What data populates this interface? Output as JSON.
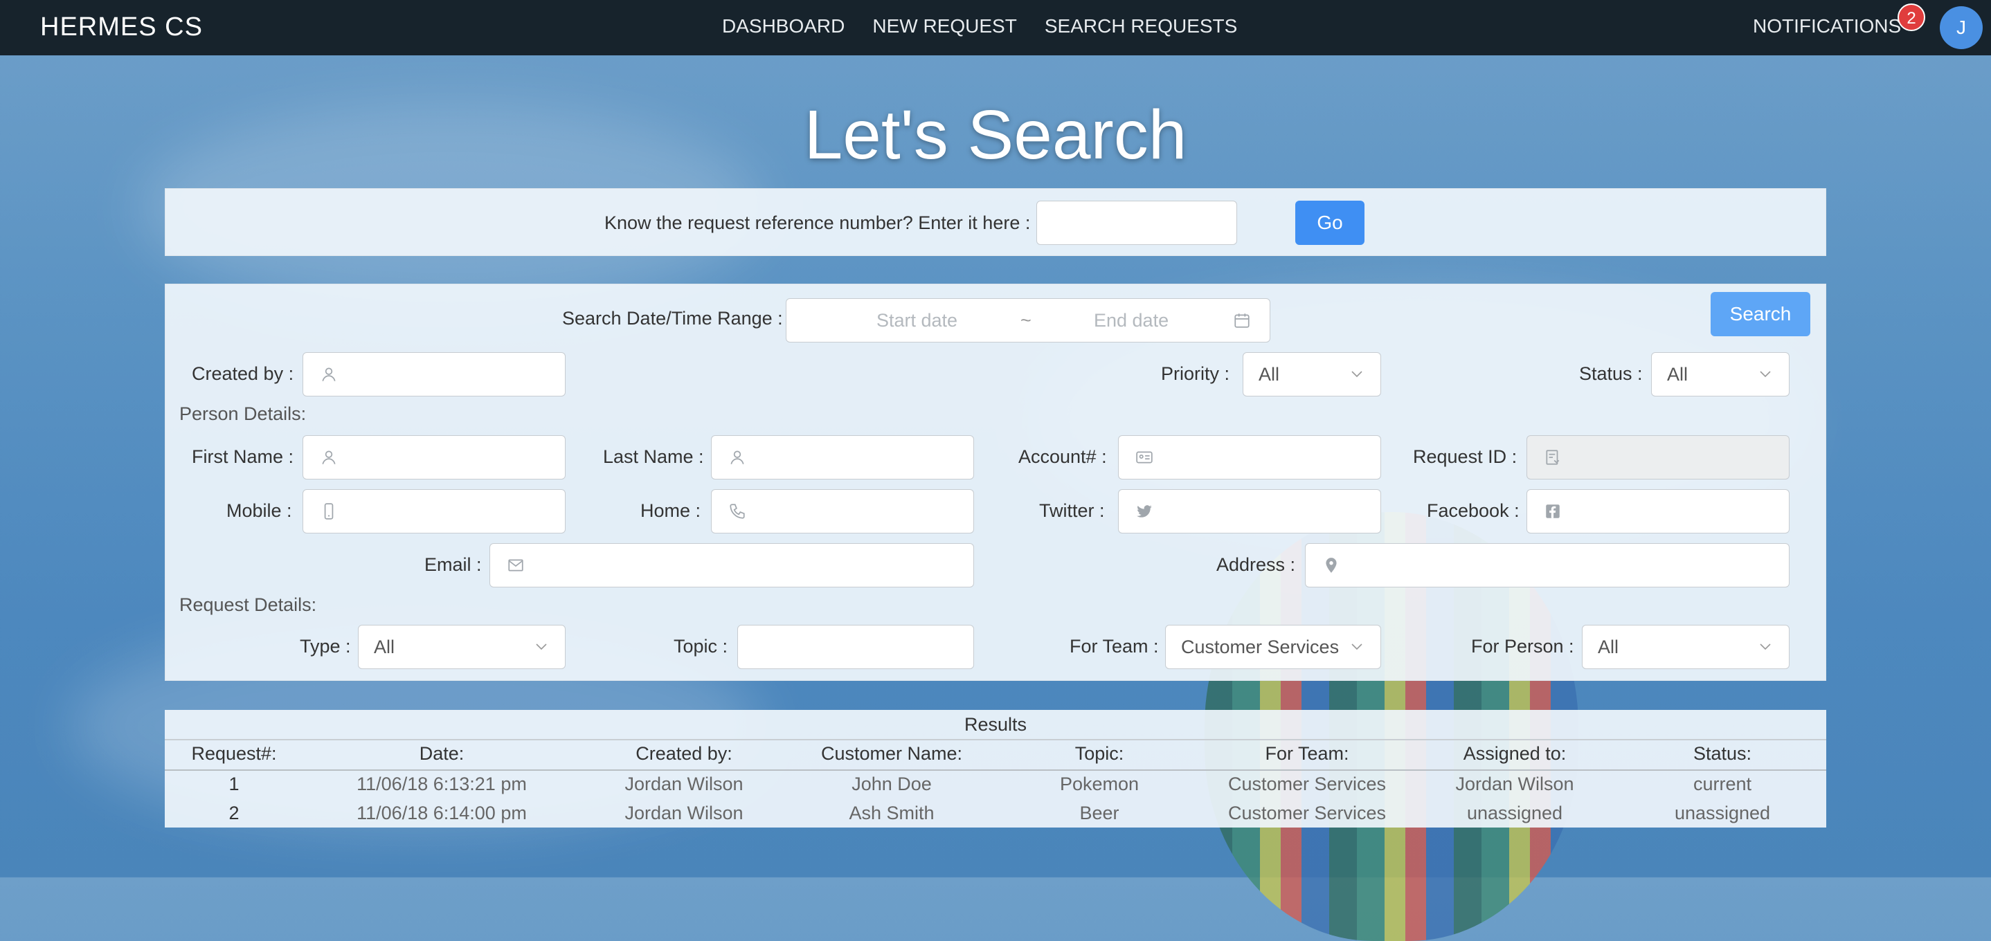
{
  "nav": {
    "brand": "HERMES CS",
    "links": [
      "DASHBOARD",
      "NEW REQUEST",
      "SEARCH REQUESTS"
    ],
    "notifications_label": "NOTIFICATIONS",
    "notifications_count": "2",
    "avatar_initial": "J"
  },
  "page_title": "Let's Search",
  "quick": {
    "label": "Know the request reference number? Enter it here :",
    "go_label": "Go"
  },
  "search": {
    "range_label": "Search Date/Time Range :",
    "start_placeholder": "Start date",
    "range_sep": "~",
    "end_placeholder": "End date",
    "search_label": "Search",
    "created_by_label": "Created by :",
    "priority_label": "Priority :",
    "priority_value": "All",
    "status_label": "Status :",
    "status_value": "All",
    "person_section": "Person Details:",
    "first_name_label": "First Name :",
    "last_name_label": "Last Name :",
    "account_label": "Account# :",
    "request_id_label": "Request ID :",
    "mobile_label": "Mobile :",
    "home_label": "Home :",
    "twitter_label": "Twitter :",
    "facebook_label": "Facebook :",
    "email_label": "Email :",
    "address_label": "Address :",
    "request_section": "Request Details:",
    "type_label": "Type :",
    "type_value": "All",
    "topic_label": "Topic :",
    "for_team_label": "For Team :",
    "for_team_value": "Customer Services",
    "for_person_label": "For Person :",
    "for_person_value": "All"
  },
  "results": {
    "title": "Results",
    "headers": [
      "Request#:",
      "Date:",
      "Created by:",
      "Customer Name:",
      "Topic:",
      "For Team:",
      "Assigned to:",
      "Status:"
    ],
    "rows": [
      [
        "1",
        "11/06/18 6:13:21 pm",
        "Jordan Wilson",
        "John Doe",
        "Pokemon",
        "Customer Services",
        "Jordan Wilson",
        "current"
      ],
      [
        "2",
        "11/06/18 6:14:00 pm",
        "Jordan Wilson",
        "Ash Smith",
        "Beer",
        "Customer Services",
        "unassigned",
        "unassigned"
      ]
    ]
  },
  "colors": {
    "navbar": "#17232c",
    "primary": "#3f8ff3",
    "badge": "#e03d3d"
  }
}
